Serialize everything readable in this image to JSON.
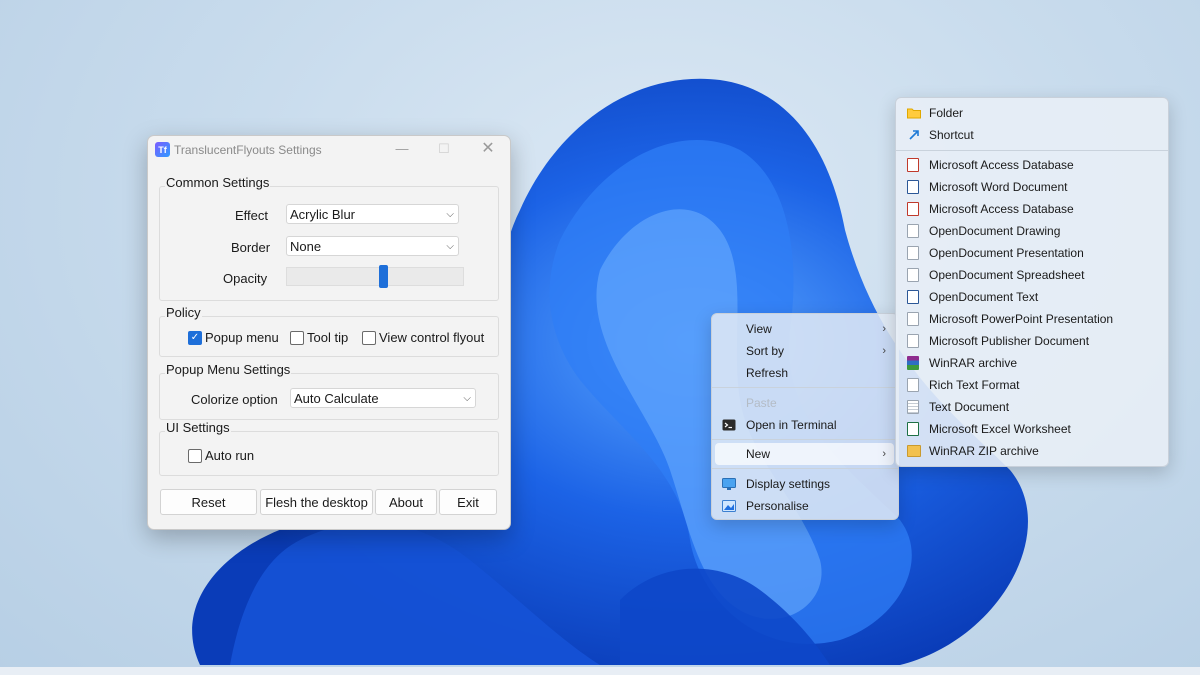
{
  "window": {
    "title": "TranslucentFlyouts Settings",
    "icon_text": "Tf",
    "controls": {
      "minimize": "—",
      "maximize": "☐",
      "close": "✕"
    }
  },
  "common": {
    "title": "Common Settings",
    "effect_label": "Effect",
    "effect_value": "Acrylic Blur",
    "border_label": "Border",
    "border_value": "None",
    "opacity_label": "Opacity",
    "opacity_level": 0.55
  },
  "policy": {
    "title": "Policy",
    "items": [
      {
        "label": "Popup menu",
        "checked": true
      },
      {
        "label": "Tool tip",
        "checked": false
      },
      {
        "label": "View control flyout",
        "checked": false
      }
    ]
  },
  "popup": {
    "title": "Popup Menu Settings",
    "colorize_label": "Colorize option",
    "colorize_value": "Auto Calculate"
  },
  "ui": {
    "title": "UI Settings",
    "autorun_label": "Auto run",
    "autorun_checked": false
  },
  "buttons": {
    "reset": "Reset",
    "flesh": "Flesh the desktop",
    "about": "About",
    "exit": "Exit"
  },
  "context_menu": {
    "view": "View",
    "sort_by": "Sort by",
    "refresh": "Refresh",
    "paste": "Paste",
    "open_terminal": "Open in Terminal",
    "new": "New",
    "display_settings": "Display settings",
    "personalise": "Personalise"
  },
  "new_submenu": [
    {
      "label": "Folder",
      "icon": "folder-icon"
    },
    {
      "label": "Shortcut",
      "icon": "shortcut-icon"
    },
    {
      "label": "Microsoft Access Database",
      "icon": "access-icon"
    },
    {
      "label": "Microsoft Word Document",
      "icon": "word-icon"
    },
    {
      "label": "Microsoft Access Database",
      "icon": "access-icon"
    },
    {
      "label": "OpenDocument Drawing",
      "icon": "document-icon"
    },
    {
      "label": "OpenDocument Presentation",
      "icon": "document-icon"
    },
    {
      "label": "OpenDocument Spreadsheet",
      "icon": "document-icon"
    },
    {
      "label": "OpenDocument Text",
      "icon": "word-icon"
    },
    {
      "label": "Microsoft PowerPoint Presentation",
      "icon": "document-icon"
    },
    {
      "label": "Microsoft Publisher Document",
      "icon": "document-icon"
    },
    {
      "label": "WinRAR archive",
      "icon": "winrar-icon"
    },
    {
      "label": "Rich Text Format",
      "icon": "document-icon"
    },
    {
      "label": "Text Document",
      "icon": "text-document-icon"
    },
    {
      "label": "Microsoft Excel Worksheet",
      "icon": "excel-icon"
    },
    {
      "label": "WinRAR ZIP archive",
      "icon": "zip-icon"
    }
  ],
  "colors": {
    "accent": "#1e6fd9",
    "bloom_dark": "#0a3ec2",
    "bloom_light": "#3f8cff"
  }
}
